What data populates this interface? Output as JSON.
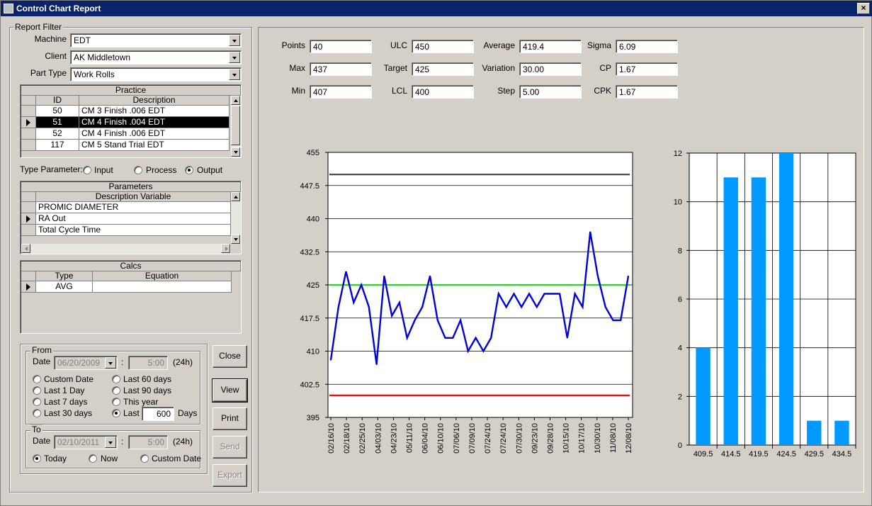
{
  "window": {
    "title": "Control Chart Report",
    "close_glyph": "×"
  },
  "report_filter": {
    "legend": "Report Filter",
    "machine": {
      "label": "Machine",
      "value": "EDT"
    },
    "client": {
      "label": "Client",
      "value": "AK Middletown"
    },
    "part_type": {
      "label": "Part Type",
      "value": "Work Rolls"
    }
  },
  "practice": {
    "title": "Practice",
    "columns": [
      "ID",
      "Description"
    ],
    "rows": [
      {
        "id": "50",
        "description": "CM 3 Finish .006 EDT"
      },
      {
        "id": "51",
        "description": "CM 4 Finish .004 EDT"
      },
      {
        "id": "52",
        "description": "CM 4 Finish .006 EDT"
      },
      {
        "id": "117",
        "description": "CM 5 Stand Trial EDT"
      }
    ]
  },
  "type_parameter": {
    "label": "Type Parameter:",
    "options": [
      "Input",
      "Process",
      "Output"
    ],
    "selected": "Output"
  },
  "parameters": {
    "title": "Parameters",
    "column": "Description Variable",
    "rows": [
      "PROMIC DIAMETER",
      "RA Out",
      "Total Cycle Time"
    ]
  },
  "calcs": {
    "title": "Calcs",
    "columns": [
      "Type",
      "Equation"
    ],
    "rows": [
      {
        "type": "AVG",
        "equation": ""
      }
    ]
  },
  "from": {
    "legend": "From",
    "date_label": "Date",
    "date": "06/20/2009",
    "colon": ":",
    "time": "5:00",
    "unit": "(24h)",
    "options": [
      "Custom Date",
      "Last 1 Day",
      "Last 7 days",
      "Last 30 days",
      "Last 60 days",
      "Last 90 days",
      "This year",
      "Last"
    ],
    "selected": "Last",
    "last_value": "600",
    "days_label": "Days"
  },
  "to": {
    "legend": "To",
    "date_label": "Date",
    "date": "02/10/2011",
    "colon": ":",
    "time": "5:00",
    "unit": "(24h)",
    "options": [
      "Today",
      "Now",
      "Custom Date"
    ],
    "selected": "Today"
  },
  "buttons": {
    "close": "Close",
    "view": "View",
    "print": "Print",
    "send": "Send",
    "export": "Export"
  },
  "stats": {
    "points": {
      "label": "Points",
      "value": "40"
    },
    "max": {
      "label": "Max",
      "value": "437"
    },
    "min": {
      "label": "Min",
      "value": "407"
    },
    "ulc": {
      "label": "ULC",
      "value": "450"
    },
    "target": {
      "label": "Target",
      "value": "425"
    },
    "lcl": {
      "label": "LCL",
      "value": "400"
    },
    "average": {
      "label": "Average",
      "value": "419.4"
    },
    "variation": {
      "label": "Variation",
      "value": "30.00"
    },
    "step": {
      "label": "Step",
      "value": "5.00"
    },
    "sigma": {
      "label": "Sigma",
      "value": "6.09"
    },
    "cp": {
      "label": "CP",
      "value": "1.67"
    },
    "cpk": {
      "label": "CPK",
      "value": "1.67"
    }
  },
  "chart_data": [
    {
      "type": "line",
      "ylim": [
        395,
        455
      ],
      "yticks": [
        "395",
        "402.5",
        "410",
        "417.5",
        "425",
        "432.5",
        "440",
        "447.5",
        "455"
      ],
      "xticks": [
        "02/16/10",
        "02/18/10",
        "02/25/10",
        "04/03/10",
        "04/23/10",
        "05/11/10",
        "06/04/10",
        "06/10/10",
        "07/06/10",
        "07/09/10",
        "07/24/10",
        "07/24/10",
        "07/30/10",
        "09/23/10",
        "09/28/10",
        "10/15/10",
        "10/17/10",
        "10/30/10",
        "11/08/10",
        "12/08/10"
      ],
      "series": [
        {
          "color": "#0000dd",
          "values": [
            408,
            420,
            428,
            421,
            425,
            420,
            407,
            427,
            418,
            421,
            413,
            417,
            420,
            427,
            417,
            413,
            413,
            417,
            410,
            413,
            410,
            413,
            423,
            420,
            423,
            420,
            423,
            420,
            423,
            423,
            423,
            413,
            423,
            420,
            437,
            427,
            420,
            417,
            417,
            427
          ]
        }
      ],
      "reference_lines": [
        {
          "value": 450,
          "color": "#404040"
        },
        {
          "value": 425,
          "color": "#22dd22"
        },
        {
          "value": 400,
          "color": "#ee0000"
        }
      ],
      "grid": true
    },
    {
      "type": "bar",
      "categories": [
        "409.5",
        "414.5",
        "419.5",
        "424.5",
        "429.5",
        "434.5"
      ],
      "values": [
        4,
        11,
        11,
        12,
        1,
        1
      ],
      "ylim": [
        0,
        12
      ],
      "yticks": [
        "0",
        "2",
        "4",
        "6",
        "8",
        "10",
        "12"
      ],
      "color": "#0099ff",
      "grid": true
    }
  ]
}
